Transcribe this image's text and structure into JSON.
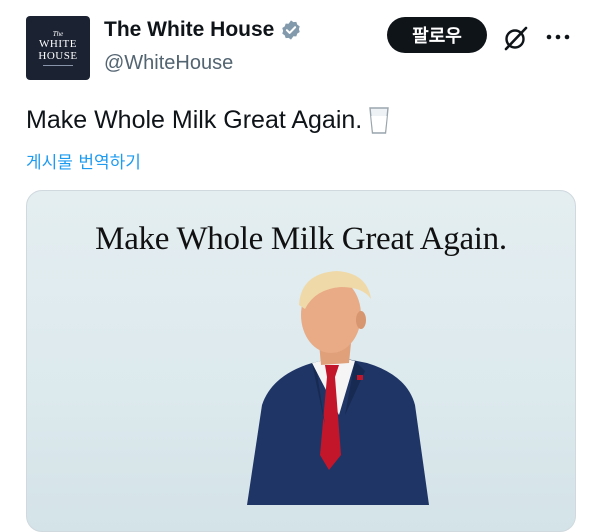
{
  "account": {
    "name": "The White House",
    "handle": "@WhiteHouse",
    "avatar": {
      "line1": "The",
      "line2": "WHITE",
      "line3": "HOUSE"
    },
    "verified_icon": "verified-badge-icon",
    "verified_color": "#829aab"
  },
  "actions": {
    "follow_label": "팔로우",
    "grok_icon": "grok-icon",
    "more_icon": "more-icon"
  },
  "tweet": {
    "text": "Make Whole Milk Great Again.",
    "emoji_icon": "milk-glass-icon",
    "translate_label": "게시물 번역하기"
  },
  "media": {
    "headline": "Make Whole Milk Great Again.",
    "image_subject": "person-figure"
  },
  "colors": {
    "link": "#1d9bf0",
    "follow_bg": "#0f1419",
    "secondary_text": "#536471"
  }
}
